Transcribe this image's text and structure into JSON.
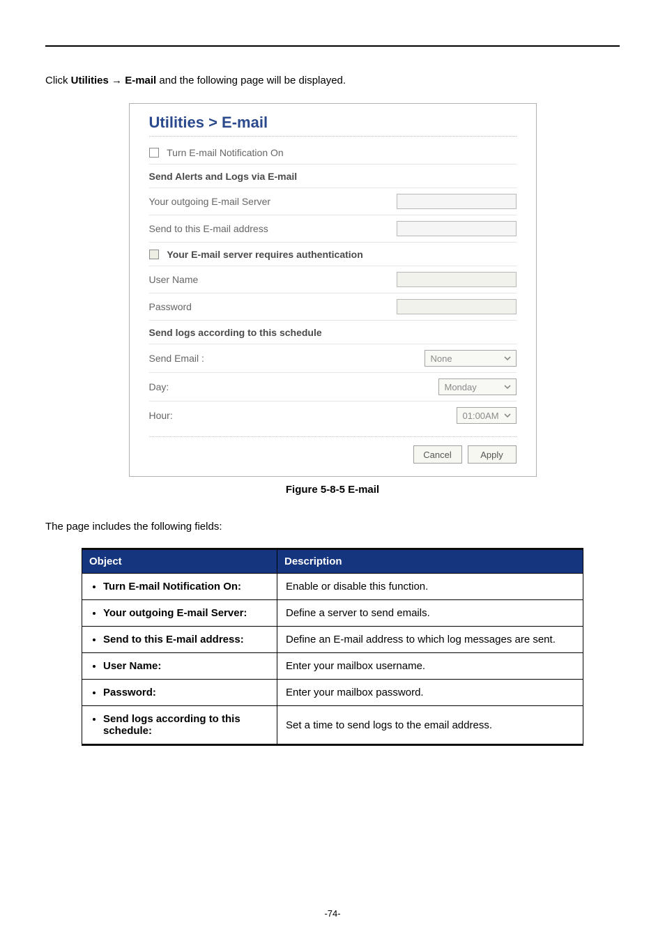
{
  "intro": {
    "prefix": "Click ",
    "bold1": "Utilities",
    "arrow": " → ",
    "bold2": "E-mail",
    "suffix": " and the following page will be displayed."
  },
  "panel": {
    "title": "Utilities > E-mail",
    "turn_on_label": "Turn E-mail Notification On",
    "section1": "Send Alerts and Logs via E-mail",
    "outgoing_label": "Your outgoing E-mail Server",
    "sendto_label": "Send to this E-mail address",
    "auth_label": "Your E-mail server requires authentication",
    "username_label": "User Name",
    "password_label": "Password",
    "section2": "Send logs according to this schedule",
    "sendemail_label": "Send Email :",
    "sendemail_value": "None",
    "day_label": "Day:",
    "day_value": "Monday",
    "hour_label": "Hour:",
    "hour_value": "01:00AM",
    "cancel": "Cancel",
    "apply": "Apply"
  },
  "figure_caption": "Figure 5-8-5 E-mail",
  "fields_intro": "The page includes the following fields:",
  "table": {
    "head_object": "Object",
    "head_desc": "Description",
    "rows": [
      {
        "obj": "Turn E-mail Notification On:",
        "desc": "Enable or disable this function."
      },
      {
        "obj": "Your outgoing E-mail Server:",
        "desc": "Define a server to send emails."
      },
      {
        "obj": "Send to this E-mail address:",
        "desc": "Define an E-mail address to which log messages are sent."
      },
      {
        "obj": "User Name:",
        "desc": "Enter your mailbox username."
      },
      {
        "obj": "Password:",
        "desc": "Enter your mailbox password."
      },
      {
        "obj": "Send logs according to this schedule:",
        "desc": "Set a time to send logs to the email address."
      }
    ]
  },
  "footer": "-74-"
}
